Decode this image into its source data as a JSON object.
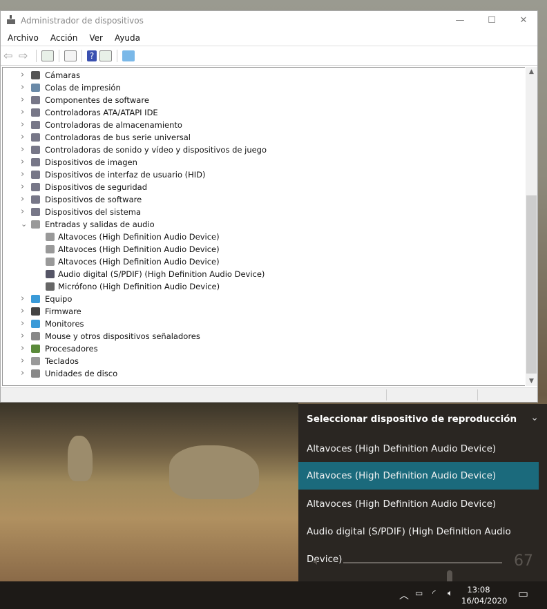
{
  "window": {
    "title": "Administrador de dispositivos",
    "minimize": "—",
    "maximize": "☐",
    "close": "✕"
  },
  "menu": [
    "Archivo",
    "Acción",
    "Ver",
    "Ayuda"
  ],
  "tree": [
    {
      "label": "Cámaras",
      "icon": "camera-icon",
      "expanded": false,
      "level": 0
    },
    {
      "label": "Colas de impresión",
      "icon": "printer-icon",
      "level": 0
    },
    {
      "label": "Componentes de software",
      "icon": "software-component-icon",
      "level": 0
    },
    {
      "label": "Controladoras ATA/ATAPI IDE",
      "icon": "ide-controller-icon",
      "level": 0
    },
    {
      "label": "Controladoras de almacenamiento",
      "icon": "storage-controller-icon",
      "level": 0
    },
    {
      "label": "Controladoras de bus serie universal",
      "icon": "usb-icon",
      "level": 0
    },
    {
      "label": "Controladoras de sonido y vídeo y dispositivos de juego",
      "icon": "sound-icon",
      "level": 0
    },
    {
      "label": "Dispositivos de imagen",
      "icon": "imaging-icon",
      "level": 0
    },
    {
      "label": "Dispositivos de interfaz de usuario (HID)",
      "icon": "hid-icon",
      "level": 0
    },
    {
      "label": "Dispositivos de seguridad",
      "icon": "security-device-icon",
      "level": 0
    },
    {
      "label": "Dispositivos de software",
      "icon": "software-device-icon",
      "level": 0
    },
    {
      "label": "Dispositivos del sistema",
      "icon": "system-device-icon",
      "level": 0
    },
    {
      "label": "Entradas y salidas de audio",
      "icon": "speaker-icon",
      "level": 0,
      "expanded": true
    },
    {
      "label": "Altavoces (High Definition Audio Device)",
      "icon": "speaker-icon",
      "level": 1
    },
    {
      "label": "Altavoces (High Definition Audio Device)",
      "icon": "speaker-icon",
      "level": 1
    },
    {
      "label": "Altavoces (High Definition Audio Device)",
      "icon": "speaker-icon",
      "level": 1
    },
    {
      "label": "Audio digital (S/PDIF) (High Definition Audio Device)",
      "icon": "digital-audio-icon",
      "level": 1
    },
    {
      "label": "Micrófono (High Definition Audio Device)",
      "icon": "microphone-icon",
      "level": 1
    },
    {
      "label": "Equipo",
      "icon": "computer-icon",
      "level": 0
    },
    {
      "label": "Firmware",
      "icon": "firmware-icon",
      "level": 0
    },
    {
      "label": "Monitores",
      "icon": "monitor-icon",
      "level": 0
    },
    {
      "label": "Mouse y otros dispositivos señaladores",
      "icon": "mouse-icon",
      "level": 0
    },
    {
      "label": "Procesadores",
      "icon": "processor-icon",
      "level": 0
    },
    {
      "label": "Teclados",
      "icon": "keyboard-icon",
      "level": 0
    },
    {
      "label": "Unidades de disco",
      "icon": "disk-drive-icon",
      "level": 0
    }
  ],
  "flyout": {
    "title": "Seleccionar dispositivo de reproducción",
    "devices": [
      "Altavoces (High Definition Audio Device)",
      "Altavoces (High Definition Audio Device)",
      "Altavoces (High Definition Audio Device)",
      "Audio digital (S/PDIF) (High Definition Audio Device)"
    ],
    "selected_index": 1,
    "volume": 67,
    "volume_label": "67"
  },
  "taskbar": {
    "time": "13:08",
    "date": "16/04/2020"
  },
  "colors": {
    "selected": "#1b6a7c",
    "flyout_bg": "#2a2622"
  }
}
